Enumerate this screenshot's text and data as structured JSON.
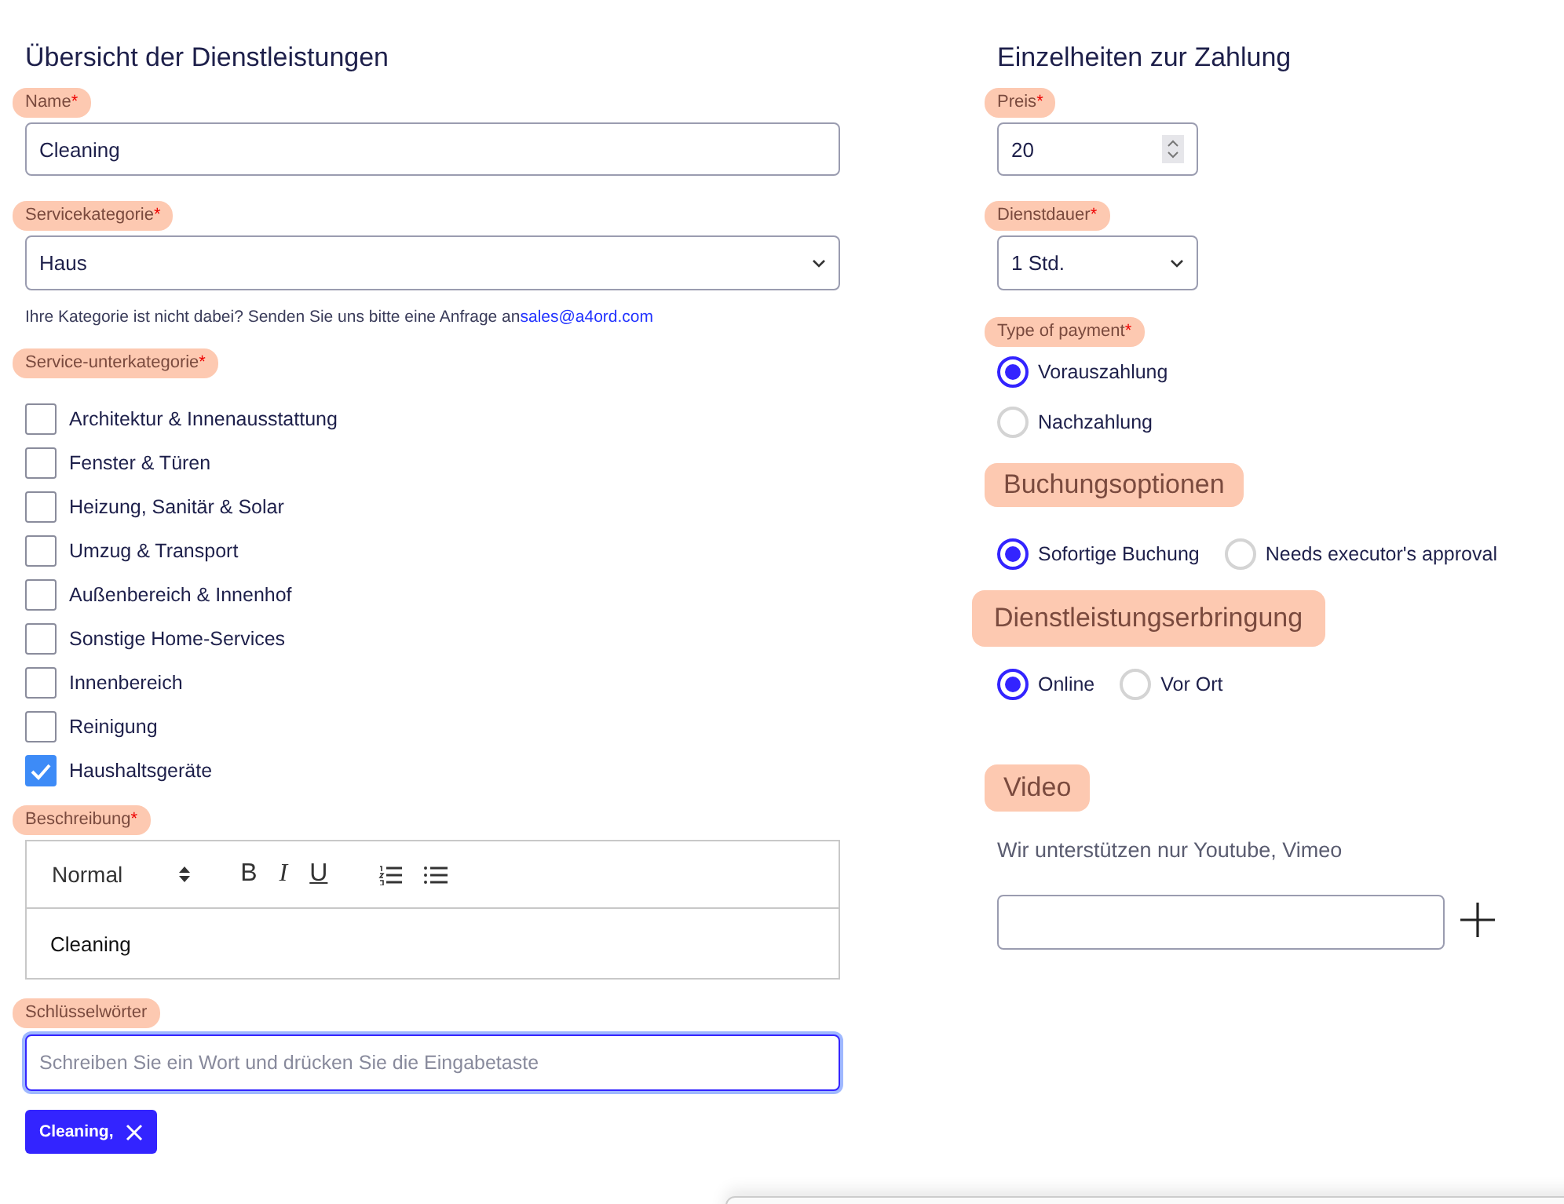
{
  "left": {
    "title": "Übersicht der Dienstleistungen",
    "name_field": {
      "label": "Name",
      "required_mark": "*",
      "value": "Cleaning"
    },
    "category_field": {
      "label": "Servicekategorie",
      "required_mark": "*",
      "value": "Haus",
      "hint": "Ihre Kategorie ist nicht dabei? Senden Sie uns bitte eine Anfrage an",
      "hint_link": "sales@a4ord.com"
    },
    "subcategory": {
      "label": "Service-unterkategorie",
      "required_mark": "*",
      "items": [
        {
          "label": "Architektur & Innenausstattung",
          "checked": false
        },
        {
          "label": "Fenster & Türen",
          "checked": false
        },
        {
          "label": "Heizung, Sanitär & Solar",
          "checked": false
        },
        {
          "label": "Umzug & Transport",
          "checked": false
        },
        {
          "label": "Außenbereich & Innenhof",
          "checked": false
        },
        {
          "label": "Sonstige Home-Services",
          "checked": false
        },
        {
          "label": "Innenbereich",
          "checked": false
        },
        {
          "label": "Reinigung",
          "checked": false
        },
        {
          "label": "Haushaltsgeräte",
          "checked": true
        }
      ]
    },
    "description": {
      "label": "Beschreibung",
      "required_mark": "*",
      "style_select": "Normal",
      "bold": "B",
      "italic": "I",
      "underline": "U",
      "content": "Cleaning"
    },
    "keywords": {
      "label": "Schlüsselwörter",
      "placeholder": "Schreiben Sie ein Wort und drücken Sie die Eingabetaste",
      "tags": [
        "Cleaning,"
      ]
    }
  },
  "right": {
    "title": "Einzelheiten zur Zahlung",
    "price": {
      "label": "Preis",
      "required_mark": "*",
      "value": "20"
    },
    "duration": {
      "label": "Dienstdauer",
      "required_mark": "*",
      "value": "1 Std."
    },
    "payment": {
      "label": "Type of payment",
      "required_mark": "*",
      "options": [
        {
          "label": "Vorauszahlung",
          "selected": true
        },
        {
          "label": "Nachzahlung",
          "selected": false
        }
      ]
    },
    "booking": {
      "heading": "Buchungsoptionen",
      "options": [
        {
          "label": "Sofortige Buchung",
          "selected": true
        },
        {
          "label": "Needs executor's approval",
          "selected": false
        }
      ]
    },
    "delivery": {
      "heading": "Dienstleistungserbringung",
      "options": [
        {
          "label": "Online",
          "selected": true
        },
        {
          "label": "Vor Ort",
          "selected": false
        }
      ]
    },
    "video": {
      "heading": "Video",
      "note": "Wir unterstützen nur Youtube, Vimeo"
    }
  }
}
